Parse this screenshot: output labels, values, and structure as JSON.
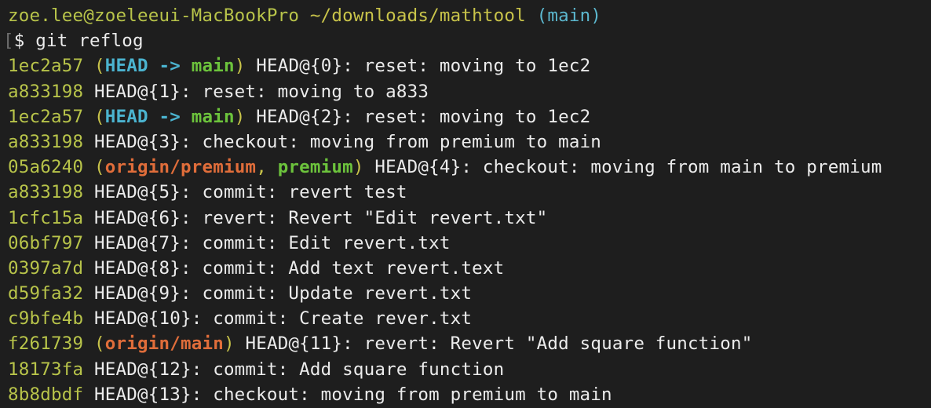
{
  "prompt": {
    "user_host": "zoe.lee@zoeleeui-MacBookPro",
    "path": "~/downloads/mathtool",
    "branch": "(main)",
    "bracket": "[",
    "command_line": "$ git reflog"
  },
  "colors": {
    "background": "#1e1e1e",
    "hash": "#b8c44a",
    "head_ref": "#4bb4d0",
    "local_branch": "#6cc33c",
    "remote_branch": "#e06d3a",
    "text": "#ececec"
  },
  "entries": [
    {
      "hash": "1ec2a57",
      "refs": [
        {
          "text": "HEAD -> ",
          "kind": "head"
        },
        {
          "text": "main",
          "kind": "local"
        }
      ],
      "message": "HEAD@{0}: reset: moving to 1ec2"
    },
    {
      "hash": "a833198",
      "refs": [],
      "message": "HEAD@{1}: reset: moving to a833"
    },
    {
      "hash": "1ec2a57",
      "refs": [
        {
          "text": "HEAD -> ",
          "kind": "head"
        },
        {
          "text": "main",
          "kind": "local"
        }
      ],
      "message": "HEAD@{2}: reset: moving to 1ec2"
    },
    {
      "hash": "a833198",
      "refs": [],
      "message": "HEAD@{3}: checkout: moving from premium to main"
    },
    {
      "hash": "05a6240",
      "refs": [
        {
          "text": "origin/premium",
          "kind": "remote"
        },
        {
          "text": ", ",
          "kind": "sep"
        },
        {
          "text": "premium",
          "kind": "local"
        }
      ],
      "message": "HEAD@{4}: checkout: moving from main to premium"
    },
    {
      "hash": "a833198",
      "refs": [],
      "message": "HEAD@{5}: commit: revert test"
    },
    {
      "hash": "1cfc15a",
      "refs": [],
      "message": "HEAD@{6}: revert: Revert \"Edit revert.txt\""
    },
    {
      "hash": "06bf797",
      "refs": [],
      "message": "HEAD@{7}: commit: Edit revert.txt"
    },
    {
      "hash": "0397a7d",
      "refs": [],
      "message": "HEAD@{8}: commit: Add text revert.text"
    },
    {
      "hash": "d59fa32",
      "refs": [],
      "message": "HEAD@{9}: commit: Update revert.txt"
    },
    {
      "hash": "c9bfe4b",
      "refs": [],
      "message": "HEAD@{10}: commit: Create rever.txt"
    },
    {
      "hash": "f261739",
      "refs": [
        {
          "text": "origin/main",
          "kind": "remote"
        }
      ],
      "message": "HEAD@{11}: revert: Revert \"Add square function\""
    },
    {
      "hash": "18173fa",
      "refs": [],
      "message": "HEAD@{12}: commit: Add square function"
    },
    {
      "hash": "8b8dbdf",
      "refs": [],
      "message": "HEAD@{13}: checkout: moving from premium to main"
    }
  ]
}
